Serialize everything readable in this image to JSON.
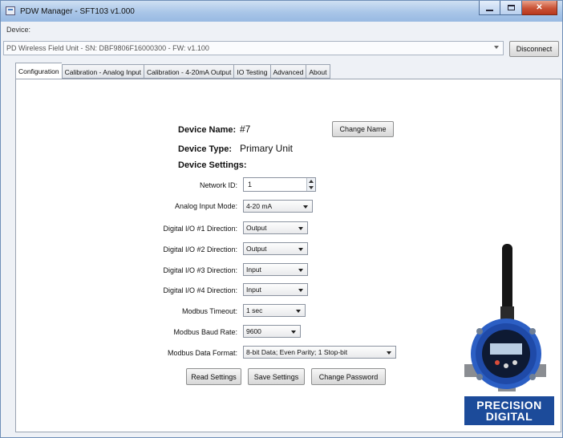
{
  "window": {
    "title": "PDW Manager - SFT103 v1.000"
  },
  "device": {
    "label": "Device:",
    "selected": "PD Wireless Field Unit - SN: DBF9806F16000300 - FW: v1.100",
    "disconnect_label": "Disconnect"
  },
  "tabs": [
    {
      "label": "Configuration",
      "active": true
    },
    {
      "label": "Calibration - Analog Input"
    },
    {
      "label": "Calibration - 4-20mA Output"
    },
    {
      "label": "IO Testing"
    },
    {
      "label": "Advanced"
    },
    {
      "label": "About"
    }
  ],
  "config": {
    "device_name_label": "Device Name:",
    "device_name": "#7",
    "change_name_label": "Change Name",
    "device_type_label": "Device Type:",
    "device_type": "Primary Unit",
    "device_settings_label": "Device Settings:",
    "network_id_label": "Network ID:",
    "network_id": "1",
    "analog_mode_label": "Analog Input Mode:",
    "analog_mode": "4-20 mA",
    "dio1_label": "Digital I/O #1  Direction:",
    "dio1": "Output",
    "dio2_label": "Digital I/O #2  Direction:",
    "dio2": "Output",
    "dio3_label": "Digital I/O #3  Direction:",
    "dio3": "Input",
    "dio4_label": "Digital I/O #4  Direction:",
    "dio4": "Input",
    "modbus_timeout_label": "Modbus Timeout:",
    "modbus_timeout": "1 sec",
    "baud_label": "Modbus Baud Rate:",
    "baud": "9600",
    "data_format_label": "Modbus Data Format:",
    "data_format": "8-bit Data; Even Parity; 1 Stop-bit",
    "read_label": "Read Settings",
    "save_label": "Save Settings",
    "password_label": "Change Password"
  },
  "logo": {
    "line1": "PRECISION",
    "line2": "DIGITAL"
  }
}
